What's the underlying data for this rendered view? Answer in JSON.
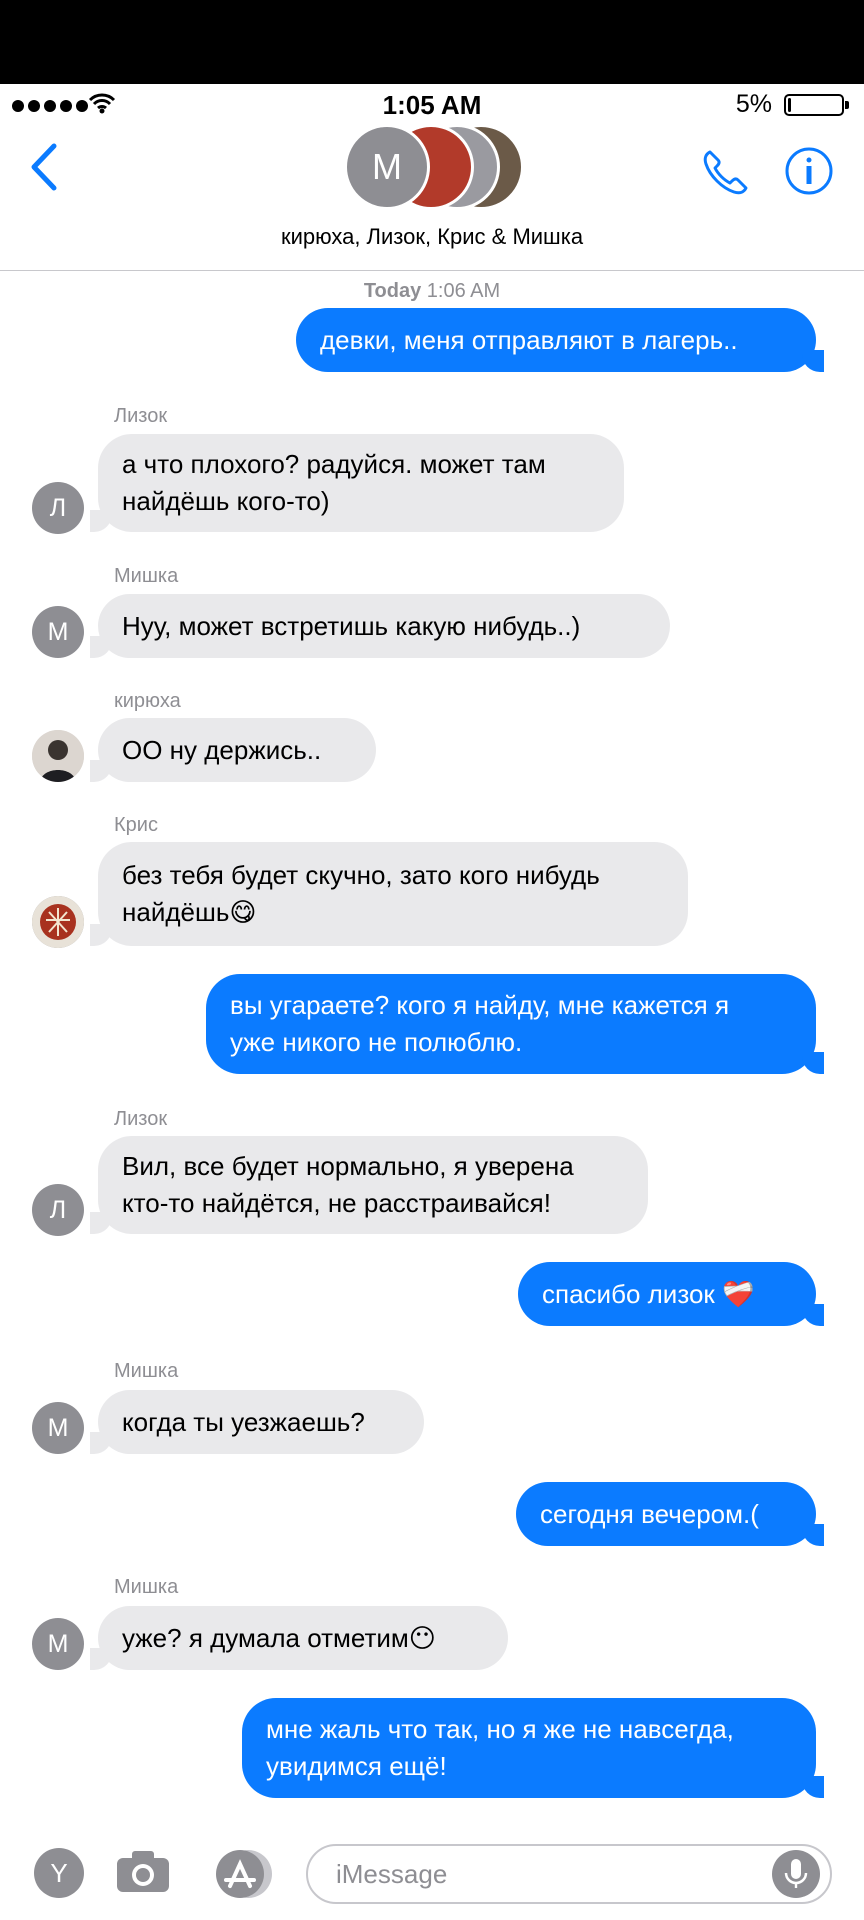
{
  "status": {
    "time": "1:05 AM",
    "battery": "5%",
    "battery_level": 0.05
  },
  "header": {
    "group_title": "кирюха, Лизок, Крис & Мишка",
    "main_avatar_initial": "М",
    "colors": {
      "accent": "#0b7bff"
    }
  },
  "timestamp": {
    "day": "Today",
    "time": "1:06 AM"
  },
  "messages": [
    {
      "text": "девки, меня отправляют в лагерь.."
    },
    {
      "sender": "Лизок",
      "initial": "Л",
      "text": "а что плохого? радуйся. может там\nнайдёшь кого-то)"
    },
    {
      "sender": "Мишка",
      "initial": "М",
      "text": "Нуу, может встретишь какую нибудь..)"
    },
    {
      "sender": "кирюха",
      "text": "ОО ну держись.."
    },
    {
      "sender": "Крис",
      "text": "без тебя будет скучно, зато кого нибудь\nнайдёшь😋"
    },
    {
      "text": "вы угараете? кого я найду, мне кажется я\nуже никого не полюблю."
    },
    {
      "sender": "Лизок",
      "initial": "Л",
      "text": "Вил, все будет нормально, я уверена\nкто-то найдётся, не расстраивайся!"
    },
    {
      "text": "спасибо лизок ❤️‍🩹"
    },
    {
      "sender": "Мишка",
      "initial": "М",
      "text": "когда ты уезжаешь?"
    },
    {
      "text": "сегодня вечером.("
    },
    {
      "sender": "Мишка",
      "initial": "М",
      "text": "уже? я думала отметим😶"
    },
    {
      "text": "мне жаль что так, но я же не навсегда,\nувидимся ещё!"
    }
  ],
  "input": {
    "placeholder": "iMessage",
    "left_button": "Y"
  }
}
